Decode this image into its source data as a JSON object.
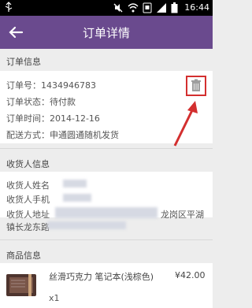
{
  "status_bar": {
    "time": "16:44",
    "icons": [
      "usb-icon",
      "mute-icon",
      "wifi-icon",
      "sim-icon",
      "signal-icon",
      "battery-icon"
    ]
  },
  "header": {
    "title": "订单详情",
    "back_icon": "arrow-left-icon"
  },
  "order_info": {
    "heading": "订单信息",
    "order_no": "订单号：1434946783",
    "status": "订单状态：待付款",
    "time": "订单时间：2014-12-16",
    "delivery": "配送方式：申通圆通随机发货",
    "delete_icon": "trash-icon"
  },
  "recipient": {
    "heading": "收货人信息",
    "name_label": "收货人姓名",
    "phone_label": "收货人手机",
    "address_label": "收货人地址",
    "address_tail": "龙岗区平湖",
    "address_line2": "镇长龙东路"
  },
  "product": {
    "heading": "商品信息",
    "name": "丝滑巧克力 笔记本(浅棕色)",
    "price": "¥42.00",
    "qty": "x1"
  },
  "colors": {
    "title_bar": "#6a4a8e",
    "annotation": "#d32f2f",
    "background": "#ededed"
  }
}
